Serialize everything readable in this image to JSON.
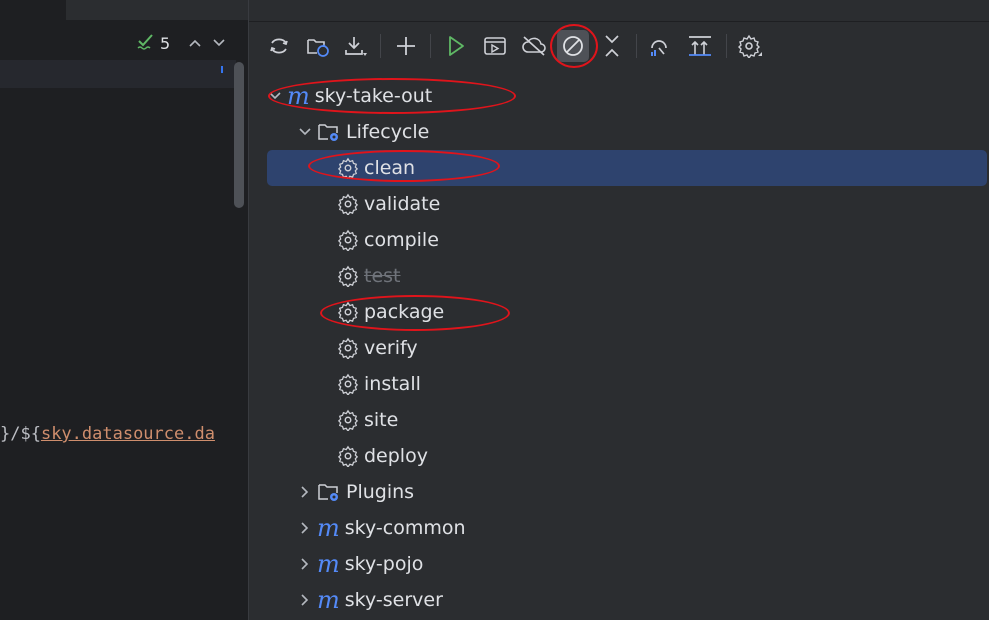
{
  "editor": {
    "inspection_count": "5",
    "code_line": {
      "prefix": "}/${",
      "property": "sky.datasource.da"
    }
  },
  "toolbar": {
    "buttons": [
      {
        "name": "reload-all-projects",
        "icon": "reload-icon"
      },
      {
        "name": "generate-sources",
        "icon": "folder-refresh-icon"
      },
      {
        "name": "download-sources",
        "icon": "download-icon"
      },
      {
        "name": "add-maven-project",
        "icon": "plus-icon"
      },
      {
        "name": "run-maven-build",
        "icon": "run-icon"
      },
      {
        "name": "execute-maven-goal",
        "icon": "execute-icon"
      },
      {
        "name": "toggle-offline-mode",
        "icon": "offline-icon"
      },
      {
        "name": "skip-tests-mode",
        "icon": "skip-tests-icon",
        "pressed": true
      },
      {
        "name": "collapse-all",
        "icon": "collapse-icon"
      },
      {
        "name": "analyze-dependencies",
        "icon": "analyze-icon"
      },
      {
        "name": "show-dependencies",
        "icon": "dependencies-icon"
      },
      {
        "name": "maven-settings",
        "icon": "gear-icon"
      }
    ]
  },
  "tree": {
    "root": {
      "label": "sky-take-out",
      "expanded": true
    },
    "lifecycle": {
      "label": "Lifecycle",
      "expanded": true,
      "goals": [
        {
          "label": "clean",
          "selected": true,
          "disabled": false
        },
        {
          "label": "validate",
          "selected": false,
          "disabled": false
        },
        {
          "label": "compile",
          "selected": false,
          "disabled": false
        },
        {
          "label": "test",
          "selected": false,
          "disabled": true
        },
        {
          "label": "package",
          "selected": false,
          "disabled": false
        },
        {
          "label": "verify",
          "selected": false,
          "disabled": false
        },
        {
          "label": "install",
          "selected": false,
          "disabled": false
        },
        {
          "label": "site",
          "selected": false,
          "disabled": false
        },
        {
          "label": "deploy",
          "selected": false,
          "disabled": false
        }
      ]
    },
    "plugins": {
      "label": "Plugins",
      "expanded": false
    },
    "modules": [
      {
        "label": "sky-common",
        "expanded": false
      },
      {
        "label": "sky-pojo",
        "expanded": false
      },
      {
        "label": "sky-server",
        "expanded": false
      }
    ]
  },
  "colors": {
    "panel_bg": "#2b2d30",
    "editor_bg": "#1e1f22",
    "selection": "#2e436e",
    "maven_icon": "#548af7",
    "run_green": "#5fb865",
    "annotation_red": "#e0141b",
    "property_orange": "#cf8e6d"
  }
}
